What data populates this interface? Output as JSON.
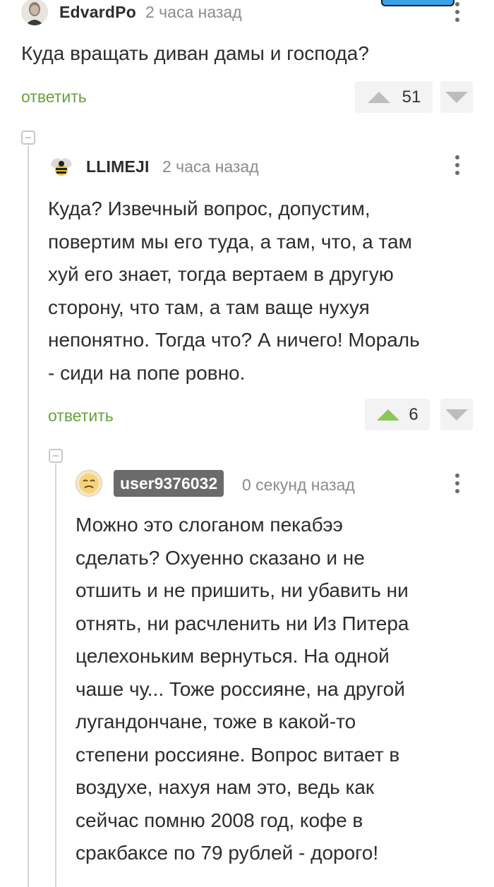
{
  "comments": [
    {
      "username": "EdvardPo",
      "time": "2 часа назад",
      "text": "Куда вращать диван дамы и господа?",
      "reply_label": "ответить",
      "rating": "51"
    },
    {
      "username": "LLIMEJI",
      "time": "2 часа назад",
      "text_lines": [
        "Куда? Извечный вопрос, допустим,",
        "повертим мы его туда, а там, что, а там",
        "хуй его знает, тогда вертаем в другую",
        "сторону, что там, а там ваще нухуя",
        "непонятно. Тогда что? А ничего! Мораль",
        "- сиди на попе ровно."
      ],
      "reply_label": "ответить",
      "rating": "6"
    },
    {
      "username": "user9376032",
      "time": "0 секунд назад",
      "text_lines": [
        "Можно это слоганом пекабээ",
        "сделать? Охуенно сказано и не",
        "отшить и не пришить, ни убавить ни",
        "отнять, ни расчленить ни Из Питера",
        "целехоньким вернуться. На одной",
        "чаше чу... Тоже россияне, на другой",
        "лугандончане, тоже в какой-то",
        "степени россияне. Вопрос витает в",
        "воздухе, нахуя нам это, ведь как",
        "сейчас помню 2008 год, кофе в",
        "сракбаксе по 79 рублей - дорого!"
      ]
    }
  ],
  "icons": {
    "more": "more-vertical-icon",
    "upvote": "upvote-arrow-icon",
    "downvote": "downvote-arrow-icon",
    "collapse": "collapse-thread-icon"
  },
  "colors": {
    "reply_green": "#67a23b",
    "upvoted_green": "#8ac858",
    "vote_gray": "#bdbdbd",
    "badge_gray": "#6b6b6b"
  }
}
